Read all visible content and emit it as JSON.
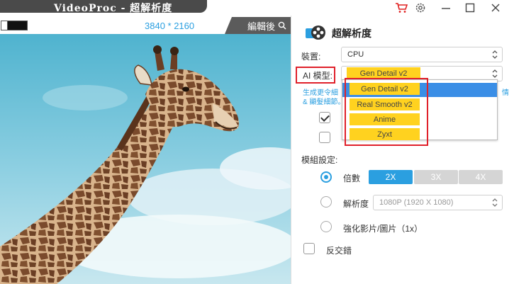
{
  "app": {
    "title": "VideoProc - 超解析度",
    "icons": [
      "cart-icon",
      "gear-icon",
      "minimize-icon",
      "maximize-icon",
      "close-icon"
    ]
  },
  "preview": {
    "resolution": "3840 * 2160",
    "edit_tab_label": "編輯後"
  },
  "panel": {
    "title": "超解析度",
    "device_label": "裝置:",
    "device_value": "CPU",
    "ai_model_label": "AI 模型:",
    "ai_model_value": "Gen Detail v2",
    "dropdown_options": [
      "Gen Detail v2",
      "Real Smooth v2",
      "Anime",
      "Zyxt"
    ],
    "hint_line1": "生成更令細",
    "hint_line1_tail": "情",
    "hint_line2": "& 顯髮細節。",
    "module_settings_label": "模組設定:",
    "scale_label": "倍數",
    "scale_options": [
      "2X",
      "3X",
      "4X"
    ],
    "scale_selected": "2X",
    "resolution_label": "解析度",
    "resolution_value": "1080P (1920 X 1080)",
    "enhance_label": "強化影片/圖片（1x）",
    "deinterlace_label": "反交錯"
  },
  "colors": {
    "accent": "#2b9fe0",
    "highlight": "#ffd21f",
    "annotation": "#e0202a",
    "titlebar": "#4a4a4a"
  }
}
